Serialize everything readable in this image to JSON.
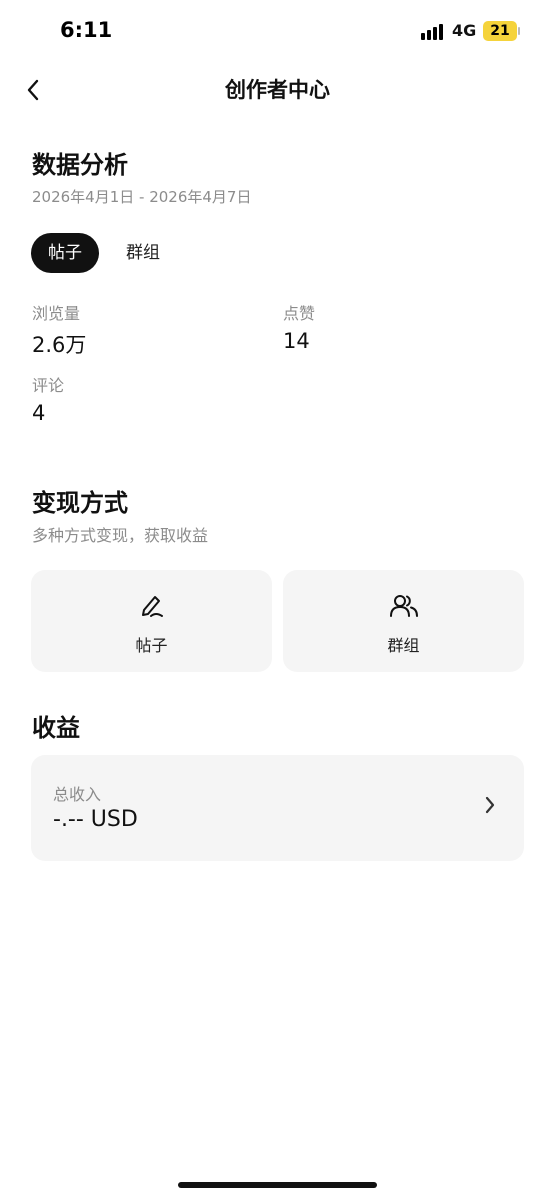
{
  "status_bar": {
    "time": "6:11",
    "network": "4G",
    "battery": "21"
  },
  "nav": {
    "title": "创作者中心",
    "back_icon": "chevron-left-icon"
  },
  "analytics": {
    "title": "数据分析",
    "date_range": "2026年4月1日 - 2026年4月7日",
    "tabs": [
      {
        "label": "帖子",
        "active": true
      },
      {
        "label": "群组",
        "active": false
      }
    ],
    "stats": [
      {
        "label": "浏览量",
        "value": "2.6万"
      },
      {
        "label": "点赞",
        "value": "14"
      },
      {
        "label": "评论",
        "value": "4"
      }
    ]
  },
  "monetization": {
    "title": "变现方式",
    "subtitle": "多种方式变现，获取收益",
    "options": [
      {
        "label": "帖子",
        "icon": "pen-icon"
      },
      {
        "label": "群组",
        "icon": "users-icon"
      }
    ]
  },
  "earnings": {
    "title": "收益",
    "total_label": "总收入",
    "total_value": "-.-- USD",
    "chevron_icon": "chevron-right-icon"
  }
}
